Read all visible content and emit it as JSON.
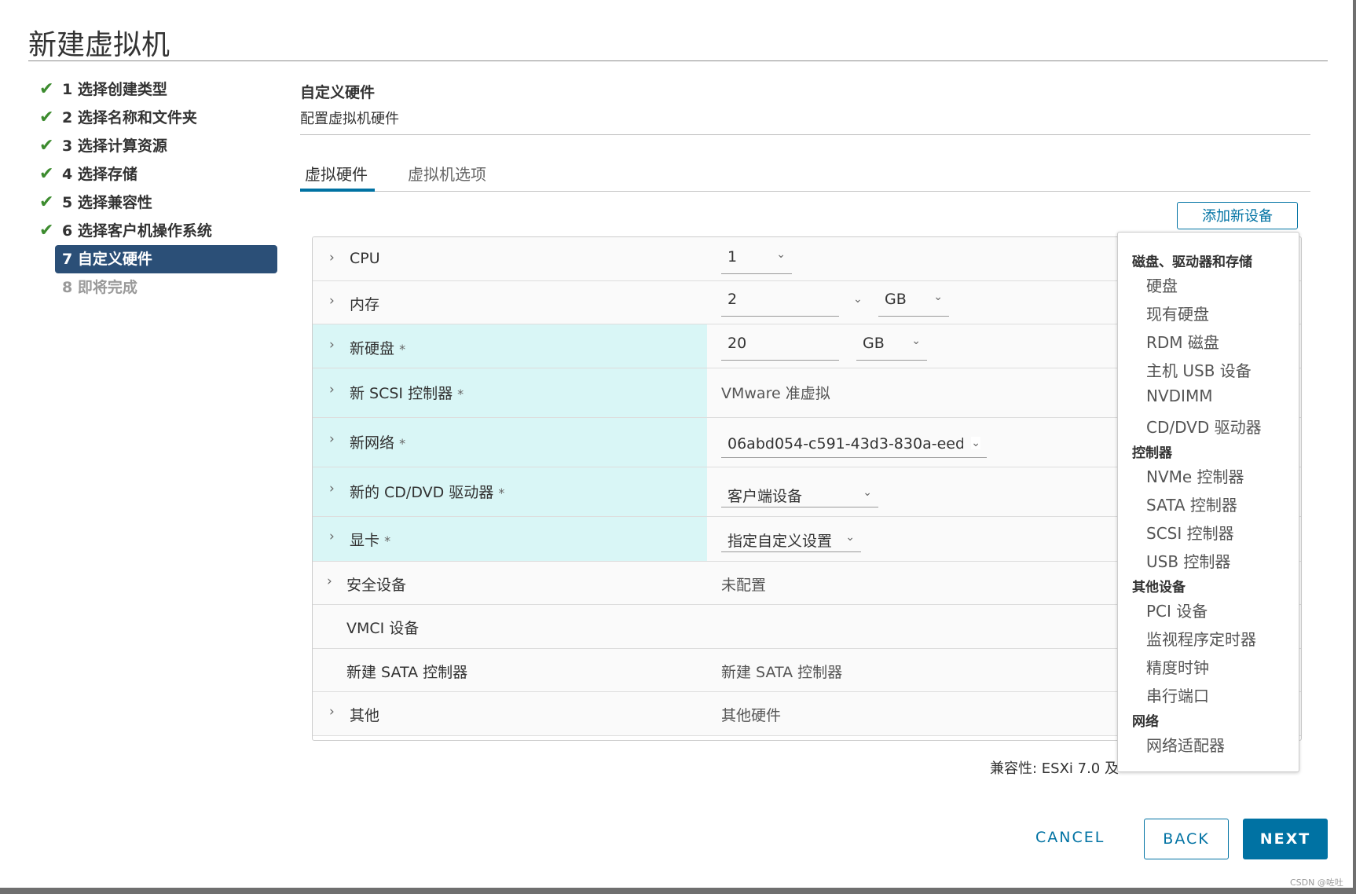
{
  "dialog": {
    "title": "新建虚拟机"
  },
  "steps": [
    {
      "label": "1 选择创建类型",
      "state": "done"
    },
    {
      "label": "2 选择名称和文件夹",
      "state": "done"
    },
    {
      "label": "3 选择计算资源",
      "state": "done"
    },
    {
      "label": "4 选择存储",
      "state": "done"
    },
    {
      "label": "5 选择兼容性",
      "state": "done"
    },
    {
      "label": "6 选择客户机操作系统",
      "state": "done"
    },
    {
      "label": "7 自定义硬件",
      "state": "active"
    },
    {
      "label": "8 即将完成",
      "state": "disabled"
    }
  ],
  "section": {
    "title": "自定义硬件",
    "subtitle": "配置虚拟机硬件"
  },
  "tabs": [
    {
      "label": "虚拟硬件",
      "active": true
    },
    {
      "label": "虚拟机选项",
      "active": false
    }
  ],
  "add_device_button": "添加新设备",
  "hardware": {
    "cpu": {
      "label": "CPU",
      "value": "1"
    },
    "memory": {
      "label": "内存",
      "value": "2",
      "unit": "GB"
    },
    "new_disk": {
      "label": "新硬盘",
      "required": "*",
      "value": "20",
      "unit": "GB"
    },
    "new_scsi": {
      "label": "新 SCSI 控制器",
      "required": "*",
      "value": "VMware 准虚拟"
    },
    "new_network": {
      "label": "新网络",
      "required": "*",
      "value": "06abd054-c591-43d3-830a-eed"
    },
    "new_cddvd": {
      "label": "新的 CD/DVD 驱动器",
      "required": "*",
      "value": "客户端设备"
    },
    "video_card": {
      "label": "显卡",
      "required": "*",
      "value": "指定自定义设置"
    },
    "security": {
      "label": "安全设备",
      "value": "未配置"
    },
    "vmci": {
      "label": "VMCI 设备"
    },
    "sata": {
      "label": "新建 SATA 控制器",
      "value": "新建 SATA 控制器"
    },
    "other": {
      "label": "其他",
      "value": "其他硬件"
    }
  },
  "compatibility": "兼容性: ESXi 7.0 及",
  "menu": {
    "groups": [
      {
        "title": "磁盘、驱动器和存储",
        "items": [
          "硬盘",
          "现有硬盘",
          "RDM 磁盘",
          "主机 USB 设备",
          "NVDIMM",
          "CD/DVD 驱动器"
        ]
      },
      {
        "title": "控制器",
        "items": [
          "NVMe 控制器",
          "SATA 控制器",
          "SCSI 控制器",
          "USB 控制器"
        ]
      },
      {
        "title": "其他设备",
        "items": [
          "PCI 设备",
          "监视程序定时器",
          "精度时钟",
          "串行端口"
        ]
      },
      {
        "title": "网络",
        "items": [
          "网络适配器"
        ]
      }
    ]
  },
  "footer": {
    "cancel": "CANCEL",
    "back": "BACK",
    "next": "NEXT"
  },
  "watermark": "CSDN @咗吐",
  "icons": {
    "check": "check-icon",
    "chevron_right": "chevron-right-icon",
    "chevron_down": "chevron-down-icon"
  },
  "colors": {
    "accent": "#0072a3",
    "step_active": "#2b4f77",
    "check": "#3c8b2e",
    "highlight_row": "#d9f6f6"
  }
}
